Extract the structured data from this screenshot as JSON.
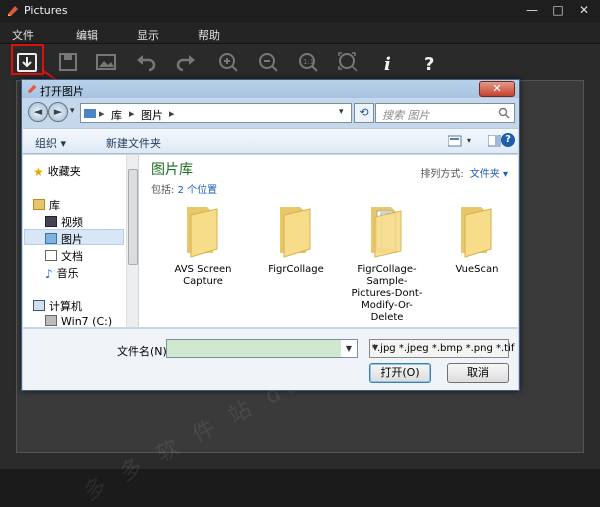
{
  "app": {
    "title": "Pictures",
    "window_controls": {
      "minimize": "—",
      "maximize": "□",
      "close": "✕"
    },
    "menu": [
      "文件",
      "编辑",
      "显示",
      "帮助"
    ],
    "toolbar_icons": [
      "open-folder-icon",
      "save-icon",
      "image-icon",
      "undo-icon",
      "redo-icon",
      "zoom-in-icon",
      "zoom-out-icon",
      "actual-size-icon",
      "fit-window-icon",
      "info-icon",
      "help-icon"
    ],
    "info_glyph": "i",
    "help_glyph": "?",
    "highlight_color": "#e01010"
  },
  "dialog": {
    "title": "打开图片",
    "close": "✕",
    "nav": {
      "back": "◄",
      "forward": "►",
      "dropdown": "▾"
    },
    "breadcrumb": [
      "库",
      "图片"
    ],
    "breadcrumb_sep": "▸",
    "refresh": "⟲",
    "search_placeholder": "搜索 图片",
    "commands": {
      "organize": "组织 ▾",
      "new_folder": "新建文件夹",
      "help": "?"
    },
    "sidebar": {
      "favorites": "收藏夹",
      "libraries": "库",
      "library_items": [
        "视频",
        "图片",
        "文档",
        "音乐"
      ],
      "computer": "计算机",
      "drives": [
        "Win7 (C:)"
      ]
    },
    "library": {
      "title": "图片库",
      "includes_label": "包括:",
      "includes_link": "2 个位置",
      "arrange_label": "排列方式:",
      "arrange_value": "文件夹 ▾"
    },
    "folders": [
      {
        "name": "AVS Screen Capture"
      },
      {
        "name": "FigrCollage"
      },
      {
        "name": "FigrCollage-Sample-Pictures-Dont-Modify-Or-Delete"
      },
      {
        "name": "VueScan"
      }
    ],
    "filename_label": "文件名(N):",
    "filename_value": "",
    "filter": "*.jpg *.jpeg *.bmp *.png *.tif",
    "dropdown_arrow": "▼",
    "open_button": "打开(O)",
    "cancel_button": "取消"
  },
  "watermark": "多 多 软 件 站 duoduoo.com"
}
